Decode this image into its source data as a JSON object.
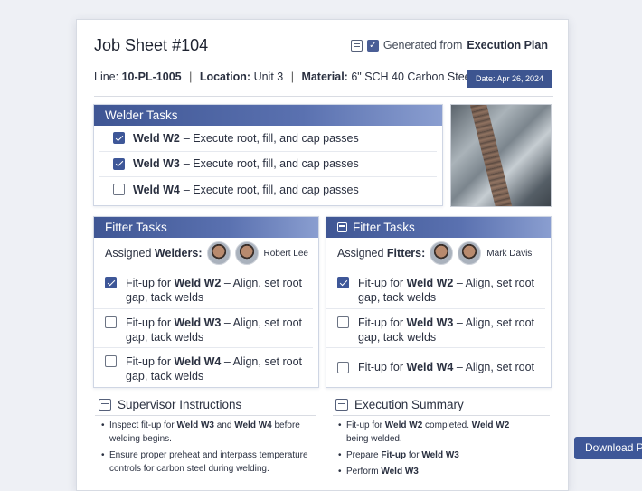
{
  "header": {
    "title": "Job Sheet #104",
    "generated_prefix": "Generated from",
    "generated_source": "Execution Plan"
  },
  "info": {
    "line_label": "Line:",
    "line_value": "10-PL-1005",
    "location_label": "Location:",
    "location_value": "Unit 3",
    "material_label": "Material:",
    "material_value": "6\" SCH 40 Carbon Steel",
    "date": "Date: Apr 26, 2024"
  },
  "welder_tasks": {
    "title": "Welder Tasks",
    "items": [
      {
        "weld": "Weld W2",
        "desc": "– Execute root, fill, and cap passes",
        "checked": true
      },
      {
        "weld": "Weld W3",
        "desc": "– Execute root, fill, and cap passes",
        "checked": true
      },
      {
        "weld": "Weld W4",
        "desc": "– Execute root, fill, and cap passes",
        "checked": false
      }
    ]
  },
  "fitter_tasks_left": {
    "title": "Fitter Tasks",
    "assigned_prefix": "Assigned",
    "assigned_role": "Welders:",
    "assignee_name": "Robert Lee",
    "items": [
      {
        "prefix": "Fit-up for",
        "weld": "Weld W2",
        "desc": "– Align, set root gap, tack welds",
        "checked": true
      },
      {
        "prefix": "Fit-up for",
        "weld": "Weld W3",
        "desc": "– Align, set root gap, tack welds",
        "checked": false
      },
      {
        "prefix": "Fit-up for",
        "weld": "Weld W4",
        "desc": "– Align, set root gap, tack welds",
        "checked": false
      }
    ]
  },
  "fitter_tasks_right": {
    "title": "Fitter Tasks",
    "assigned_prefix": "Assigned",
    "assigned_role": "Fitters:",
    "assignee_name": "Mark Davis",
    "items": [
      {
        "prefix": "Fit-up for",
        "weld": "Weld W2",
        "desc": "– Align, set root gap, tack welds",
        "checked": true
      },
      {
        "prefix": "Fit-up for",
        "weld": "Weld W3",
        "desc": "– Align, set root gap, tack welds",
        "checked": false
      },
      {
        "prefix": "Fit-up for",
        "weld": "Weld W4",
        "desc": "– Align, set root",
        "checked": false
      }
    ]
  },
  "supervisor": {
    "title": "Supervisor Instructions",
    "items": [
      "Inspect fit-up for Weld W3 and Weld W4 before welding begins.",
      "Ensure proper preheat and interpass temperature controls for carbon steel during welding."
    ]
  },
  "summary": {
    "title": "Execution Summary",
    "items": [
      "Fit-up for Weld W2 completed. Weld W2 being welded.",
      "Prepare Fit-up for Weld W3",
      "Perform Weld W3"
    ]
  },
  "download_label": "Download P",
  "colors": {
    "accent": "#3e5798",
    "header_gradient_end": "#8a9ed0"
  },
  "icons": [
    "document-icon",
    "check-badge-icon",
    "clipboard-icon",
    "checklist-icon",
    "id-card-icon"
  ]
}
